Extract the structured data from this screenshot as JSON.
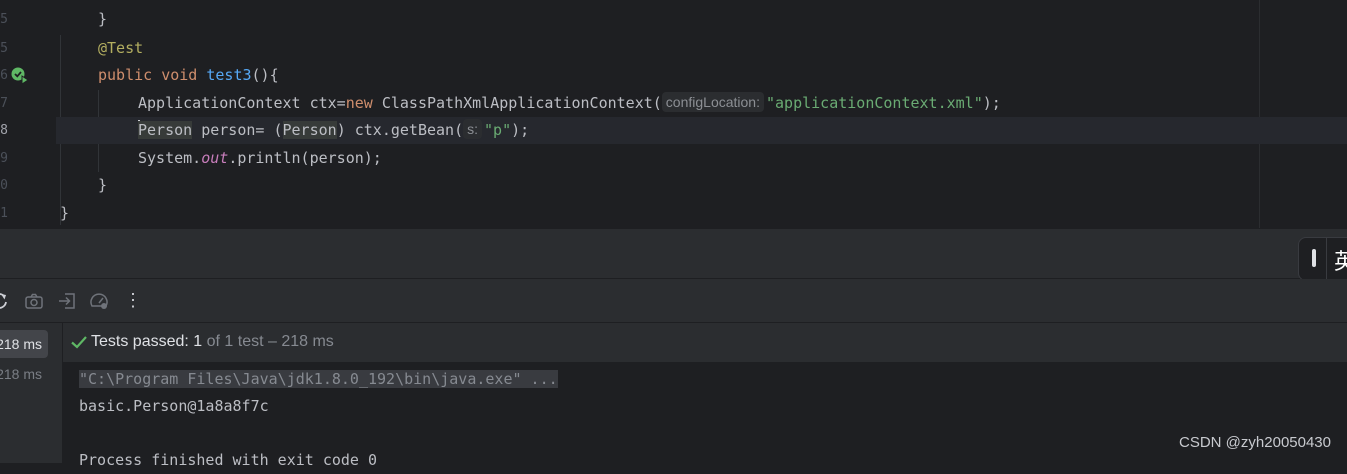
{
  "editor": {
    "line_numbers": [
      "5",
      "5",
      "6",
      "7",
      "8",
      "9",
      "0",
      "1"
    ],
    "lines": {
      "close_brace_1": "}",
      "annotation": "@Test",
      "method_kw_public": "public",
      "method_kw_void": "void",
      "method_name": "test3",
      "method_rest": "(){",
      "l1_type": "ApplicationContext",
      "l1_var": " ctx=",
      "l1_new": "new",
      "l1_ctor": " ClassPathXmlApplicationContext(",
      "l1_hint": "configLocation:",
      "l1_str": "\"applicationContext.xml\"",
      "l1_end": ");",
      "l2_type": "Person",
      "l2_mid": " person= (",
      "l2_cast": "Person",
      "l2_call": ") ctx.getBean(",
      "l2_hint": "s:",
      "l2_str": "\"p\"",
      "l2_end": ");",
      "l3_sys": "System.",
      "l3_out": "out",
      "l3_rest": ".println(person);",
      "close_brace_2": "}",
      "close_brace_3": "}"
    }
  },
  "ime": {
    "char": "英"
  },
  "toolbar": {
    "icons": [
      "restart-icon",
      "camera-icon",
      "import-icon",
      "gauge-icon",
      "more-icon"
    ],
    "more_label": "⋮"
  },
  "tree": {
    "items": [
      {
        "label": "218 ms",
        "selected": true
      },
      {
        "label": "218 ms",
        "selected": false
      }
    ]
  },
  "status": {
    "passed_label": "Tests passed: 1",
    "detail": " of 1 test – 218 ms"
  },
  "output": {
    "lines": [
      "\"C:\\Program Files\\Java\\jdk1.8.0_192\\bin\\java.exe\" ...",
      "basic.Person@1a8a8f7c",
      "",
      "Process finished with exit code 0"
    ]
  },
  "watermark": "CSDN @zyh20050430",
  "colors": {
    "editor_bg": "#1e1f22",
    "panel_bg": "#2b2d30",
    "keyword": "#cf8e6d",
    "function": "#56a8f5",
    "string": "#6aab73",
    "annotation": "#b3ae60",
    "error": "#f75464",
    "success": "#5fb865"
  }
}
